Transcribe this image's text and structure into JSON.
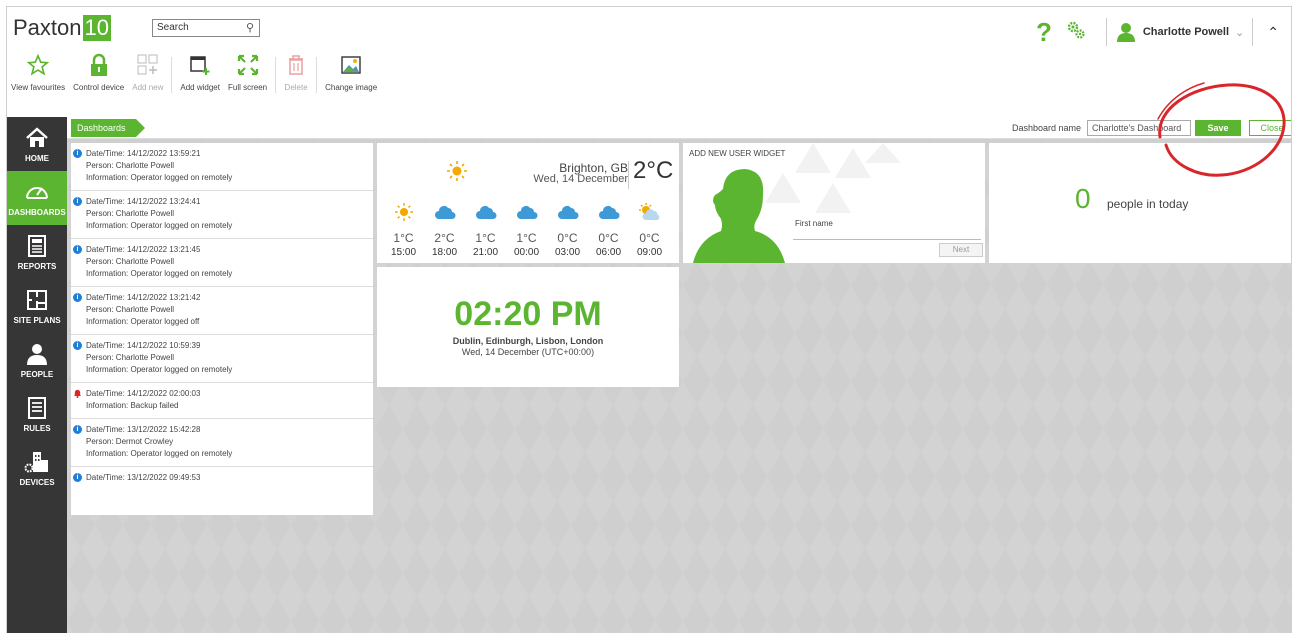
{
  "header": {
    "logo_text": "Paxton",
    "logo_version": "10",
    "search_placeholder": "Search",
    "user_name": "Charlotte Powell",
    "help_glyph": "?"
  },
  "toolbar": {
    "items": [
      {
        "label": "View favourites",
        "icon": "star-icon",
        "enabled": true
      },
      {
        "label": "Control device",
        "icon": "lock-icon",
        "enabled": true
      },
      {
        "label": "Add new",
        "icon": "add-new-icon",
        "enabled": false
      },
      {
        "label": "Add widget",
        "icon": "add-widget-icon",
        "enabled": true
      },
      {
        "label": "Full screen",
        "icon": "full-screen-icon",
        "enabled": true
      },
      {
        "label": "Delete",
        "icon": "trash-icon",
        "enabled": false
      },
      {
        "label": "Change image",
        "icon": "image-icon",
        "enabled": true
      }
    ]
  },
  "sidebar": {
    "items": [
      {
        "label": "HOME",
        "icon": "home-icon"
      },
      {
        "label": "DASHBOARDS",
        "icon": "dashboard-gauge-icon",
        "active": true
      },
      {
        "label": "REPORTS",
        "icon": "reports-icon"
      },
      {
        "label": "SITE PLANS",
        "icon": "site-plans-icon"
      },
      {
        "label": "PEOPLE",
        "icon": "person-icon"
      },
      {
        "label": "RULES",
        "icon": "rules-icon"
      },
      {
        "label": "DEVICES",
        "icon": "devices-icon"
      }
    ]
  },
  "breadcrumb": "Dashboards",
  "dashboard": {
    "name_label": "Dashboard name",
    "name_value": "Charlotte's Dashboard",
    "save_label": "Save",
    "close_label": "Close"
  },
  "events": [
    {
      "datetime": "Date/Time: 14/12/2022 13:59:21",
      "person": "Person: Charlotte Powell",
      "info": "Information: Operator logged on remotely",
      "type": "info"
    },
    {
      "datetime": "Date/Time: 14/12/2022 13:24:41",
      "person": "Person: Charlotte Powell",
      "info": "Information: Operator logged on remotely",
      "type": "info"
    },
    {
      "datetime": "Date/Time: 14/12/2022 13:21:45",
      "person": "Person: Charlotte Powell",
      "info": "Information: Operator logged on remotely",
      "type": "info"
    },
    {
      "datetime": "Date/Time: 14/12/2022 13:21:42",
      "person": "Person: Charlotte Powell",
      "info": "Information: Operator logged off",
      "type": "info"
    },
    {
      "datetime": "Date/Time: 14/12/2022 10:59:39",
      "person": "Person: Charlotte Powell",
      "info": "Information: Operator logged on remotely",
      "type": "info"
    },
    {
      "datetime": "Date/Time: 14/12/2022 02:00:03",
      "person": "",
      "info": "Information: Backup failed",
      "type": "alarm"
    },
    {
      "datetime": "Date/Time: 13/12/2022 15:42:28",
      "person": "Person: Dermot Crowley",
      "info": "Information: Operator logged on remotely",
      "type": "info"
    },
    {
      "datetime": "Date/Time: 13/12/2022 09:49:53",
      "person": "",
      "info": "",
      "type": "info"
    }
  ],
  "weather": {
    "city": "Brighton, GB",
    "date": "Wed, 14 December",
    "current_temp": "2°C",
    "forecast": [
      {
        "icon": "sun-icon",
        "temp": "1°C",
        "hour": "15:00"
      },
      {
        "icon": "cloud-icon",
        "temp": "2°C",
        "hour": "18:00"
      },
      {
        "icon": "cloud-icon",
        "temp": "1°C",
        "hour": "21:00"
      },
      {
        "icon": "cloud-icon",
        "temp": "1°C",
        "hour": "00:00"
      },
      {
        "icon": "cloud-icon",
        "temp": "0°C",
        "hour": "03:00"
      },
      {
        "icon": "cloud-icon",
        "temp": "0°C",
        "hour": "06:00"
      },
      {
        "icon": "sun-cloud-icon",
        "temp": "0°C",
        "hour": "09:00"
      }
    ]
  },
  "clock": {
    "time": "02:20 PM",
    "zone": "Dublin, Edinburgh, Lisbon, London",
    "date": "Wed, 14 December  (UTC+00:00)"
  },
  "add_user": {
    "title": "ADD NEW USER WIDGET",
    "field_label": "First name",
    "next_label": "Next"
  },
  "people_in": {
    "count": "0",
    "text": "people in today"
  },
  "colors": {
    "brand_green": "#5cb531",
    "sidebar_dark": "#363636",
    "info_blue": "#1f7fd6",
    "alarm_red": "#d9262b",
    "annotation_red": "#d9262b"
  }
}
